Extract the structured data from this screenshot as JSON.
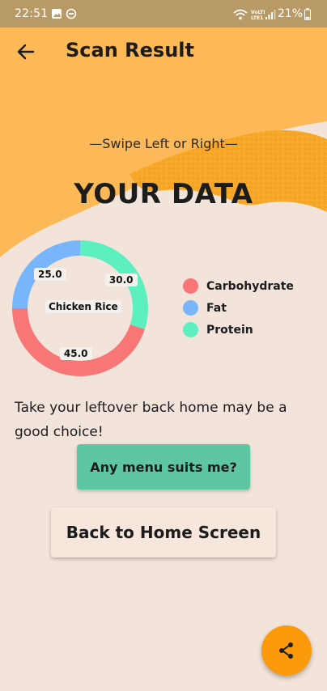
{
  "status_bar": {
    "time": "22:51",
    "battery": "21%",
    "icons": [
      "image-icon",
      "do-not-disturb-icon",
      "wifi-icon",
      "volte-icon",
      "signal-icon",
      "battery-icon"
    ]
  },
  "app_bar": {
    "title": "Scan Result",
    "back_icon": "arrow-left-icon"
  },
  "swipe_hint": "—Swipe Left or Right—",
  "heading": "YOUR DATA",
  "chart_data": {
    "type": "pie",
    "center_label": "Chicken Rice",
    "categories": [
      "Carbohydrate",
      "Fat",
      "Protein"
    ],
    "values": [
      45.0,
      25.0,
      30.0
    ],
    "value_labels": [
      "45.0",
      "25.0",
      "30.0"
    ],
    "colors": [
      "#f97676",
      "#78b6fb",
      "#5eefc0"
    ],
    "legend_position": "right"
  },
  "advice_text": "Take your leftover back home may be a good choice!",
  "buttons": {
    "menu": "Any menu suits me?",
    "home": "Back to Home Screen"
  },
  "fab_icon": "share-icon",
  "colors": {
    "accent_orange": "#fd9a0b",
    "header_yellow": "#fdb957",
    "background": "#f2e4da",
    "menu_button": "#5fc6a4"
  }
}
